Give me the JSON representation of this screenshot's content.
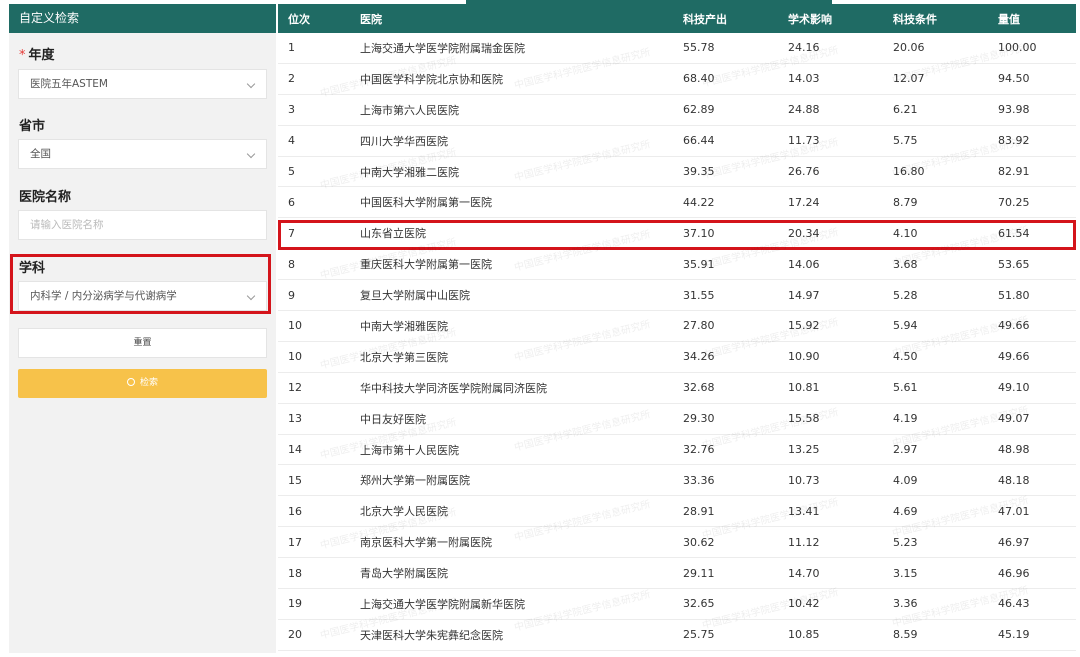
{
  "sidebar": {
    "title": "自定义检索",
    "year": {
      "label": "年度",
      "required_mark": "*",
      "value": "医院五年ASTEM"
    },
    "province": {
      "label": "省市",
      "value": "全国"
    },
    "hospital_name": {
      "label": "医院名称",
      "placeholder": "请输入医院名称"
    },
    "discipline": {
      "label": "学科",
      "value": "内科学 / 内分泌病学与代谢病学"
    },
    "reset_label": "重置",
    "search_label": "检索"
  },
  "table": {
    "columns": [
      "位次",
      "医院",
      "科技产出",
      "学术影响",
      "科技条件",
      "量值"
    ],
    "rows": [
      [
        "1",
        "上海交通大学医学院附属瑞金医院",
        "55.78",
        "24.16",
        "20.06",
        "100.00"
      ],
      [
        "2",
        "中国医学科学院北京协和医院",
        "68.40",
        "14.03",
        "12.07",
        "94.50"
      ],
      [
        "3",
        "上海市第六人民医院",
        "62.89",
        "24.88",
        "6.21",
        "93.98"
      ],
      [
        "4",
        "四川大学华西医院",
        "66.44",
        "11.73",
        "5.75",
        "83.92"
      ],
      [
        "5",
        "中南大学湘雅二医院",
        "39.35",
        "26.76",
        "16.80",
        "82.91"
      ],
      [
        "6",
        "中国医科大学附属第一医院",
        "44.22",
        "17.24",
        "8.79",
        "70.25"
      ],
      [
        "7",
        "山东省立医院",
        "37.10",
        "20.34",
        "4.10",
        "61.54"
      ],
      [
        "8",
        "重庆医科大学附属第一医院",
        "35.91",
        "14.06",
        "3.68",
        "53.65"
      ],
      [
        "9",
        "复旦大学附属中山医院",
        "31.55",
        "14.97",
        "5.28",
        "51.80"
      ],
      [
        "10",
        "中南大学湘雅医院",
        "27.80",
        "15.92",
        "5.94",
        "49.66"
      ],
      [
        "10",
        "北京大学第三医院",
        "34.26",
        "10.90",
        "4.50",
        "49.66"
      ],
      [
        "12",
        "华中科技大学同济医学院附属同济医院",
        "32.68",
        "10.81",
        "5.61",
        "49.10"
      ],
      [
        "13",
        "中日友好医院",
        "29.30",
        "15.58",
        "4.19",
        "49.07"
      ],
      [
        "14",
        "上海市第十人民医院",
        "32.76",
        "13.25",
        "2.97",
        "48.98"
      ],
      [
        "15",
        "郑州大学第一附属医院",
        "33.36",
        "10.73",
        "4.09",
        "48.18"
      ],
      [
        "16",
        "北京大学人民医院",
        "28.91",
        "13.41",
        "4.69",
        "47.01"
      ],
      [
        "17",
        "南京医科大学第一附属医院",
        "30.62",
        "11.12",
        "5.23",
        "46.97"
      ],
      [
        "18",
        "青岛大学附属医院",
        "29.11",
        "14.70",
        "3.15",
        "46.96"
      ],
      [
        "19",
        "上海交通大学医学院附属新华医院",
        "32.65",
        "10.42",
        "3.36",
        "46.43"
      ],
      [
        "20",
        "天津医科大学朱宪彝纪念医院",
        "25.75",
        "10.85",
        "8.59",
        "45.19"
      ]
    ],
    "highlighted_row_rank": "7"
  },
  "watermark_text": "中国医学科学院医学信息研究所",
  "colors": {
    "header": "#1f6b64",
    "search_button": "#f7c24a",
    "highlight": "#d4141b"
  }
}
